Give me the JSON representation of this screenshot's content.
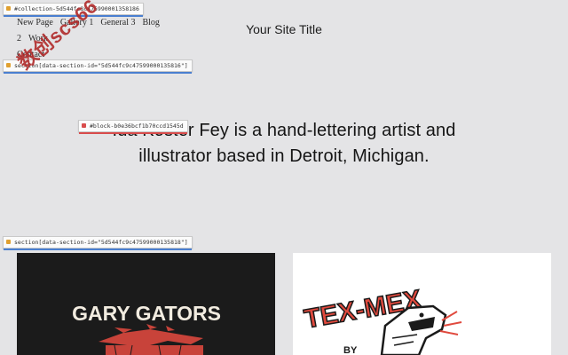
{
  "nav": {
    "items": [
      "New Page",
      "Gallery 1",
      "General 3",
      "Blog 2",
      "Work",
      "Contact"
    ]
  },
  "header": {
    "site_title": "Your Site Title"
  },
  "hero": {
    "line1": "Ida Koster Fey is a hand-lettering artist and",
    "line2": "illustrator based in Detroit, Michigan."
  },
  "inspector": {
    "collection": "#collection-5d544fc8c475990001358186",
    "section1": "section[data-section-id=\"5d544fc9c47599000135816\"]",
    "block": "#block-b0e36bcf1b70ccd1545d",
    "section2": "section[data-section-id=\"5d544fc9c47599000135818\"]"
  },
  "watermark": "数创scs66",
  "gallery": {
    "left_title": "GARY GATORS",
    "right_title": "TEX-MEX",
    "right_sub": "BY"
  },
  "colors": {
    "background": "#e4e4e6",
    "accent_blue": "#4a7fd0",
    "gator_red": "#c8433a",
    "texmex_red": "#e0493d"
  }
}
